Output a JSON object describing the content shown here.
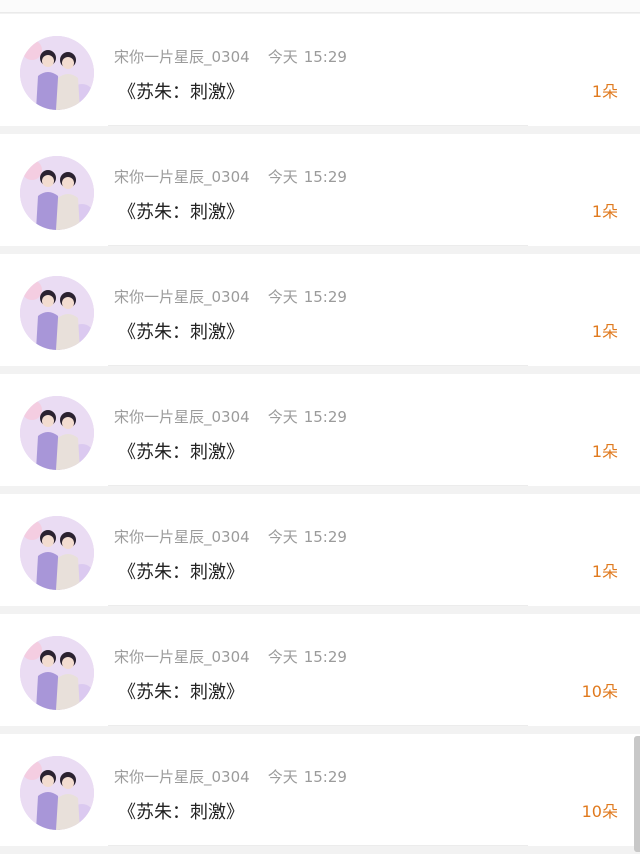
{
  "rows": [
    {
      "username": "宋你一片星辰_0304",
      "day": "今天",
      "time": "15:29",
      "gift": "《苏朱：刺激》",
      "count": "1朵"
    },
    {
      "username": "宋你一片星辰_0304",
      "day": "今天",
      "time": "15:29",
      "gift": "《苏朱：刺激》",
      "count": "1朵"
    },
    {
      "username": "宋你一片星辰_0304",
      "day": "今天",
      "time": "15:29",
      "gift": "《苏朱：刺激》",
      "count": "1朵"
    },
    {
      "username": "宋你一片星辰_0304",
      "day": "今天",
      "time": "15:29",
      "gift": "《苏朱：刺激》",
      "count": "1朵"
    },
    {
      "username": "宋你一片星辰_0304",
      "day": "今天",
      "time": "15:29",
      "gift": "《苏朱：刺激》",
      "count": "1朵"
    },
    {
      "username": "宋你一片星辰_0304",
      "day": "今天",
      "time": "15:29",
      "gift": "《苏朱：刺激》",
      "count": "10朵"
    },
    {
      "username": "宋你一片星辰_0304",
      "day": "今天",
      "time": "15:29",
      "gift": "《苏朱：刺激》",
      "count": "10朵"
    }
  ],
  "colors": {
    "count": "#e07a1e",
    "meta": "#9b9b9b",
    "title": "#222222"
  },
  "icons": {
    "avatar": "avatar-photo"
  }
}
